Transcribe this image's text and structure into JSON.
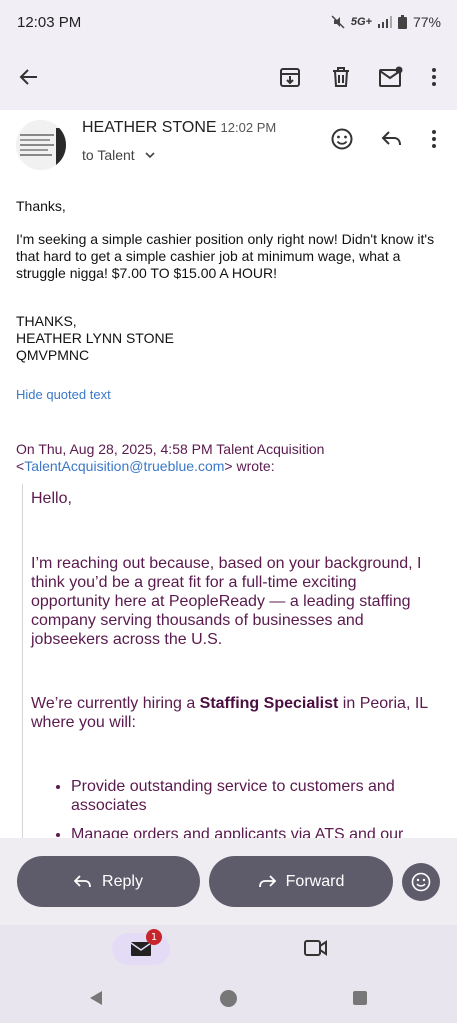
{
  "status": {
    "time": "12:03 PM",
    "network": "5G+",
    "battery": "77%"
  },
  "toolbar": {
    "back_icon": "arrow-left-icon",
    "archive_icon": "archive-icon",
    "delete_icon": "trash-icon",
    "unread_icon": "mail-unread-icon",
    "more_icon": "more-vert-icon"
  },
  "message": {
    "sender": "HEATHER STONE",
    "time": "12:02 PM",
    "to_label": "to Talent",
    "greeting": "Thanks,",
    "body": "I'm seeking a simple cashier position only right now! Didn't know it's that hard to get a simple cashier job at minimum wage, what a struggle nigga! $7.00 TO $15.00 A HOUR!",
    "sign_1": "THANKS,",
    "sign_2": "HEATHER LYNN STONE",
    "sign_3": "QMVPMNC",
    "hide_quoted": "Hide quoted text",
    "quote_head_1": "On Thu, Aug 28, 2025, 4:58 PM Talent Acquisition",
    "quote_head_lt": "<",
    "quote_head_email": "TalentAcquisition@trueblue.com",
    "quote_head_2": "> wrote:",
    "q_hello": "Hello,",
    "q_para1": "I’m reaching out because, based on your background, I think you’d be a great fit for a full-time exciting opportunity here at PeopleReady — a leading staffing company serving thousands of businesses and jobseekers across the U.S.",
    "q_para2_a": "We’re currently hiring a ",
    "q_para2_b": "Staffing Specialist",
    "q_para2_c": " in Peoria, IL where you will:",
    "q_bullets": [
      "Provide outstanding service to customers and associates",
      "Manage orders and applicants via ATS and our"
    ]
  },
  "actions": {
    "reply": "Reply",
    "forward": "Forward"
  },
  "nav": {
    "badge": "1"
  },
  "colors": {
    "accent": "#5e5c6a",
    "quote": "#5a1a4e",
    "link": "#3b78c9"
  }
}
